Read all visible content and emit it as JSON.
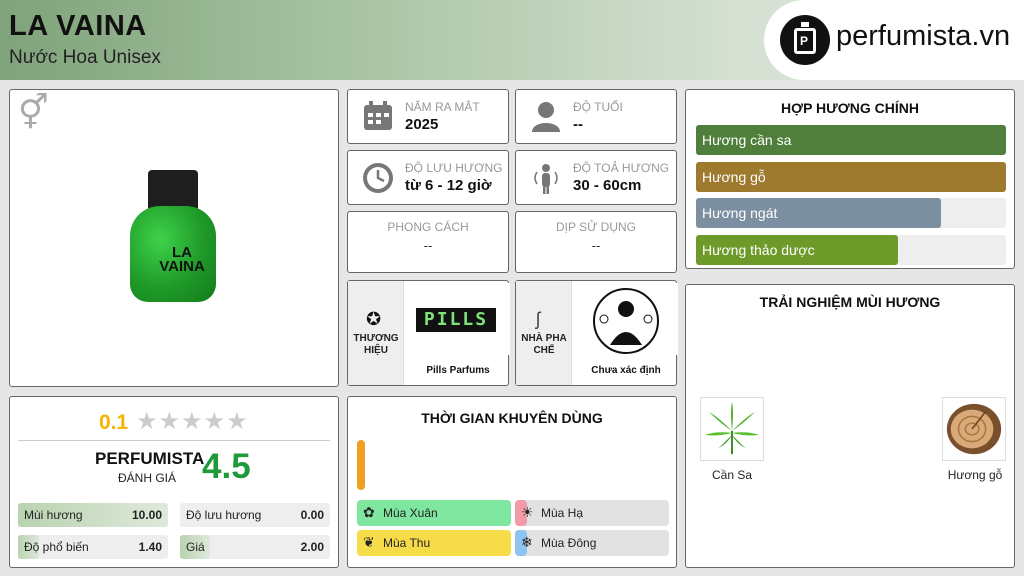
{
  "header": {
    "title": "LA VAINA",
    "subtitle": "Nước Hoa Unisex",
    "logo_text": "perfumista.vn"
  },
  "product": {
    "bottle_label": "LA VAINA",
    "gender_icon": "gender-unisex-icon"
  },
  "info": {
    "release": {
      "label": "NĂM RA MẮT",
      "value": "2025",
      "icon": "calendar-icon"
    },
    "age": {
      "label": "ĐỘ TUỔI",
      "value": "--",
      "icon": "user-icon"
    },
    "longevity": {
      "label": "ĐỘ LƯU HƯƠNG",
      "value": "từ 6 - 12 giờ",
      "icon": "clock-icon"
    },
    "sillage": {
      "label": "ĐỘ TOẢ HƯƠNG",
      "value": "30 - 60cm",
      "icon": "sillage-icon"
    },
    "style": {
      "label": "PHONG CÁCH",
      "value": "--"
    },
    "occasion": {
      "label": "DỊP SỬ DỤNG",
      "value": "--"
    }
  },
  "brand": {
    "label": "THƯƠNG HIỆU",
    "name": "Pills Parfums",
    "logo_text": "PILLS"
  },
  "perfumer": {
    "label": "NHÀ PHA CHẾ",
    "name": "Chưa xác định"
  },
  "accords": {
    "title": "HỢP HƯƠNG CHÍNH",
    "items": [
      {
        "name": "Hương cần sa",
        "level": 1.0,
        "color": "#4f7f3b"
      },
      {
        "name": "Hương gỗ",
        "level": 1.0,
        "color": "#9e7a2e"
      },
      {
        "name": "Hương ngát",
        "level": 0.79,
        "color": "#7b8fa0"
      },
      {
        "name": "Hương thảo dược",
        "level": 0.65,
        "color": "#6e9a2a"
      }
    ]
  },
  "experience": {
    "title": "TRẢI NGHIỆM MÙI HƯƠNG",
    "items": [
      {
        "name": "Cần Sa"
      },
      {
        "name": "Hương gỗ"
      }
    ]
  },
  "rating": {
    "user_score": "0.1",
    "stars": "★★★★★",
    "perfumista_label": "PERFUMISTA",
    "evaluation_label": "ĐÁNH GIÁ",
    "perfumista_score": "4.5",
    "scores": [
      {
        "label": "Mùi hương",
        "value": "10.00",
        "fill": 1.0
      },
      {
        "label": "Độ lưu hương",
        "value": "0.00",
        "fill": 0.0
      },
      {
        "label": "Độ phổ biến",
        "value": "1.40",
        "fill": 0.14
      },
      {
        "label": "Giá",
        "value": "2.00",
        "fill": 0.2
      }
    ]
  },
  "time": {
    "title": "THỜI GIAN KHUYÊN DÙNG",
    "seasons": [
      {
        "name": "Mùa Xuân",
        "color": "#7fe6a0",
        "icon": "flower-icon"
      },
      {
        "name": "Mùa Hạ",
        "color": "#f29aa6",
        "icon": "sun-icon"
      },
      {
        "name": "Mùa Thu",
        "color": "#f7dc4a",
        "icon": "leaf-icon"
      },
      {
        "name": "Mùa Đông",
        "color": "#8fc3f0",
        "icon": "snowflake-icon"
      }
    ]
  }
}
